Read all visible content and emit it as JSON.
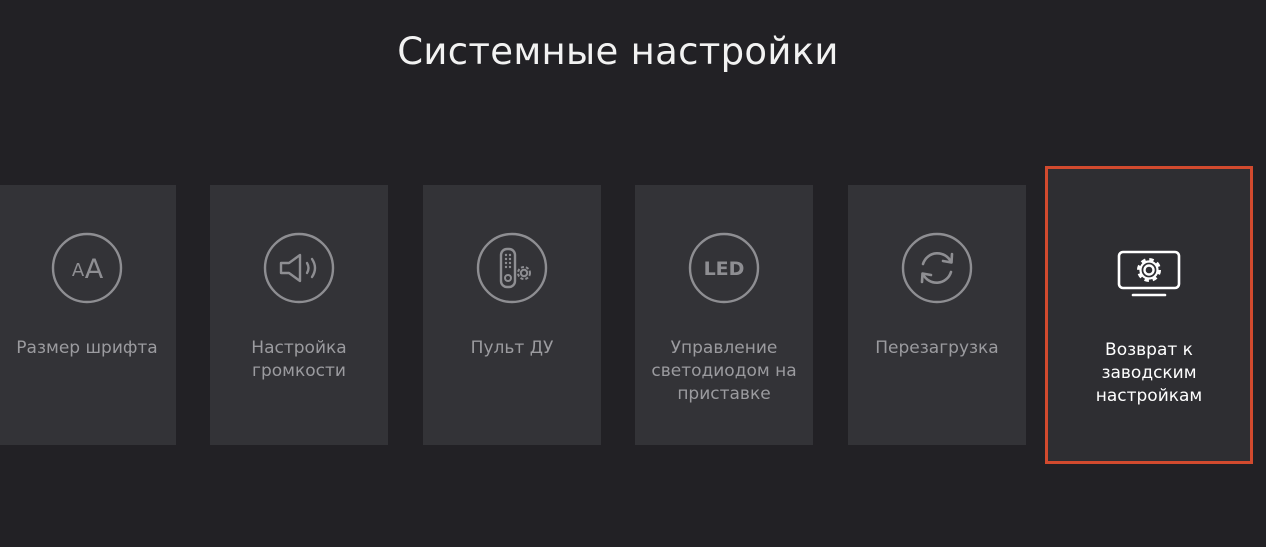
{
  "page": {
    "title": "Системные настройки"
  },
  "tiles": [
    {
      "id": "font-size",
      "label": "Размер шрифта",
      "icon": "font-size-icon"
    },
    {
      "id": "volume",
      "label": "Настройка громкости",
      "icon": "speaker-icon"
    },
    {
      "id": "remote",
      "label": "Пульт ДУ",
      "icon": "remote-control-icon"
    },
    {
      "id": "led",
      "label": "Управление светодиодом на приставке",
      "icon": "led-icon",
      "icon_text": "LED"
    },
    {
      "id": "reboot",
      "label": "Перезагрузка",
      "icon": "refresh-icon"
    },
    {
      "id": "factory-reset",
      "label": "Возврат к заводским настройкам",
      "icon": "tv-gear-icon",
      "focused": true
    }
  ],
  "colors": {
    "background": "#222125",
    "tile": "#333337",
    "tile_text": "#9b9b9f",
    "focus_border": "#d24a2e",
    "focused_text": "#ffffff"
  }
}
